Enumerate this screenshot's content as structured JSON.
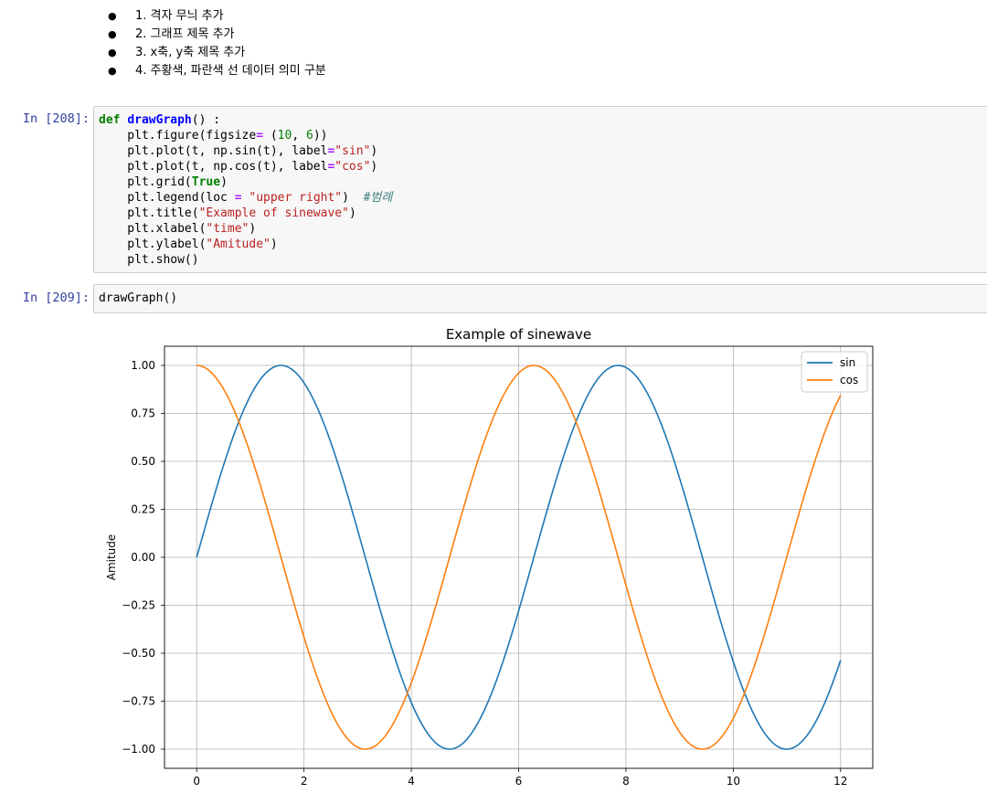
{
  "markdown": {
    "items": [
      "1. 격자 무늬 추가",
      "2. 그래프 제목 추가",
      "3. x축, y축 제목 추가",
      "4. 주황색, 파란색 선 데이터 의미 구분"
    ]
  },
  "cells": [
    {
      "prompt": "In [208]:",
      "code": {
        "def_kw": "def",
        "fn_name": "drawGraph",
        "def_tail": "() :",
        "l2a": "    plt.figure(figsize",
        "l2op": "=",
        "l2b": " (",
        "l2n1": "10",
        "l2c": ", ",
        "l2n2": "6",
        "l2d": "))",
        "l3a": "    plt.plot(t, np.sin(t), label",
        "l3op": "=",
        "l3s": "\"sin\"",
        "l3b": ")",
        "l4a": "    plt.plot(t, np.cos(t), label",
        "l4op": "=",
        "l4s": "\"cos\"",
        "l4b": ")",
        "l5a": "    plt.grid(",
        "l5k": "True",
        "l5b": ")",
        "l6a": "    plt.legend(loc ",
        "l6op": "=",
        "l6b": " ",
        "l6s": "\"upper right\"",
        "l6c": ")  ",
        "l6cm": "#범례",
        "l7a": "    plt.title(",
        "l7s": "\"Example of sinewave\"",
        "l7b": ")",
        "l8a": "    plt.xlabel(",
        "l8s": "\"time\"",
        "l8b": ")",
        "l9a": "    plt.ylabel(",
        "l9s": "\"Amitude\"",
        "l9b": ")",
        "l10": "    plt.show()"
      }
    },
    {
      "prompt": "In [209]:",
      "code": {
        "line": "drawGraph()"
      }
    }
  ],
  "chart_data": {
    "type": "line",
    "title": "Example of sinewave",
    "xlabel": "",
    "ylabel": "Amitude",
    "xlim": [
      -0.6,
      12.6
    ],
    "ylim": [
      -1.1,
      1.1
    ],
    "xticks": [
      0,
      2,
      4,
      6,
      8,
      10,
      12
    ],
    "xtick_labels": [
      "0",
      "2",
      "4",
      "6",
      "8",
      "10",
      "12"
    ],
    "yticks": [
      1.0,
      0.75,
      0.5,
      0.25,
      0.0,
      -0.25,
      -0.5,
      -0.75,
      -1.0
    ],
    "ytick_labels": [
      "1.00",
      "0.75",
      "0.50",
      "0.25",
      "0.00",
      "−0.25",
      "−0.50",
      "−0.75",
      "−1.00"
    ],
    "grid": true,
    "legend": "upper right",
    "x_range": [
      0,
      12
    ],
    "series": [
      {
        "name": "sin",
        "function": "sin",
        "color": "#1f77b4"
      },
      {
        "name": "cos",
        "function": "cos",
        "color": "#ff7f0e"
      }
    ]
  }
}
